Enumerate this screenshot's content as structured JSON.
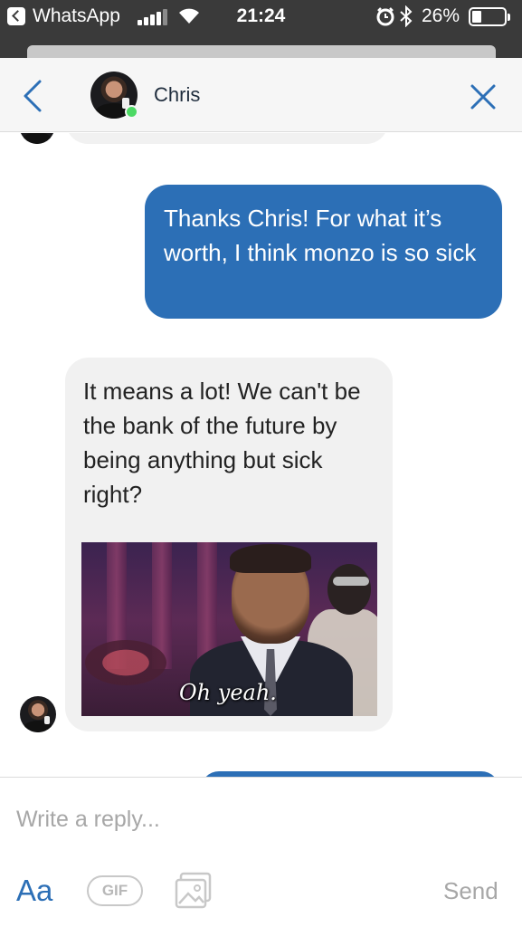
{
  "status_bar": {
    "back_app": "WhatsApp",
    "time": "21:24",
    "battery_percent": "26%",
    "battery_level": 0.26,
    "signal_bars": 4,
    "icons": [
      "back-arrow-icon",
      "signal-icon",
      "wifi-icon",
      "alarm-icon",
      "bluetooth-icon",
      "battery-icon"
    ]
  },
  "header": {
    "contact_name": "Chris",
    "online": true,
    "icons": [
      "chevron-left-icon",
      "close-icon"
    ]
  },
  "messages": [
    {
      "direction": "outgoing",
      "text": "Thanks Chris! For what it’s worth, I think monzo is so sick"
    },
    {
      "direction": "incoming",
      "text": "It means a lot! We can't be the bank of the future by being anything but sick right?",
      "gif_caption": "Oh yeah."
    }
  ],
  "composer": {
    "placeholder": "Write a reply...",
    "aa_label": "Aa",
    "gif_label": "GIF",
    "send_label": "Send"
  },
  "colors": {
    "accent": "#2c6fb6",
    "incoming_bubble": "#f1f1f1",
    "online": "#4cd964"
  }
}
